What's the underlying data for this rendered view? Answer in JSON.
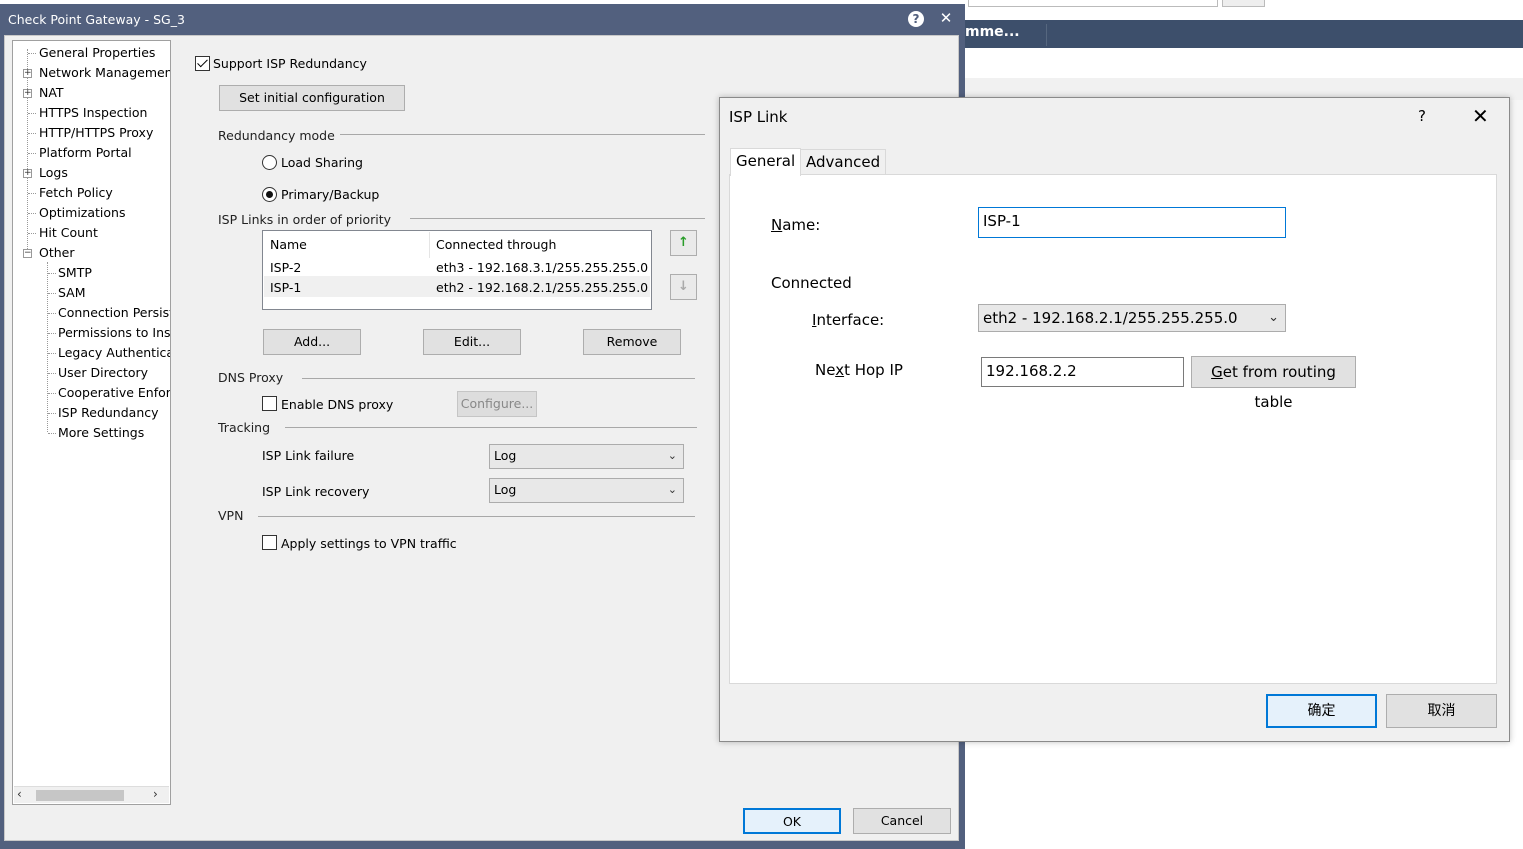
{
  "main_window": {
    "title": "Check Point Gateway - SG_3",
    "tree": {
      "items": [
        {
          "label": "General Properties",
          "expander": ""
        },
        {
          "label": "Network Management",
          "expander": "+"
        },
        {
          "label": "NAT",
          "expander": "+"
        },
        {
          "label": "HTTPS Inspection",
          "expander": ""
        },
        {
          "label": "HTTP/HTTPS Proxy",
          "expander": ""
        },
        {
          "label": "Platform Portal",
          "expander": ""
        },
        {
          "label": "Logs",
          "expander": "+"
        },
        {
          "label": "Fetch Policy",
          "expander": ""
        },
        {
          "label": "Optimizations",
          "expander": ""
        },
        {
          "label": "Hit Count",
          "expander": ""
        },
        {
          "label": "Other",
          "expander": "−"
        }
      ],
      "children": [
        "SMTP",
        "SAM",
        "Connection Persiste",
        "Permissions to Insta",
        "Legacy Authenticati",
        "User Directory",
        "Cooperative Enforc",
        "ISP Redundancy",
        "More Settings"
      ]
    },
    "form": {
      "support_isp_redundancy": "Support ISP Redundancy",
      "set_initial_configuration": "Set initial configuration",
      "redundancy_mode": "Redundancy mode",
      "load_sharing": "Load Sharing",
      "primary_backup": "Primary/Backup",
      "isp_links_title": "ISP Links in order of priority",
      "list_headers": [
        "Name",
        "Connected through"
      ],
      "list_rows": [
        {
          "name": "ISP-2",
          "through": "eth3 - 192.168.3.1/255.255.255.0"
        },
        {
          "name": "ISP-1",
          "through": "eth2 - 192.168.2.1/255.255.255.0"
        }
      ],
      "add": "Add...",
      "edit": "Edit...",
      "remove": "Remove",
      "dns_proxy": "DNS Proxy",
      "enable_dns_proxy": "Enable DNS proxy",
      "configure": "Configure...",
      "tracking": "Tracking",
      "isp_link_failure": "ISP Link failure",
      "isp_link_recovery": "ISP Link recovery",
      "failure_value": "Log",
      "recovery_value": "Log",
      "vpn": "VPN",
      "apply_vpn": "Apply settings to VPN traffic"
    },
    "ok": "OK",
    "cancel": "Cancel"
  },
  "background": {
    "header_text": "mme..."
  },
  "isp_link_dialog": {
    "title": "ISP Link",
    "help": "?",
    "tabs": [
      "General",
      "Advanced"
    ],
    "name_label": "Name:",
    "name_value": "ISP-1",
    "connected_label": "Connected",
    "interface_label": "Interface:",
    "interface_value": "eth2 - 192.168.2.1/255.255.255.0",
    "next_hop_label": "Next Hop IP",
    "next_hop_value": "192.168.2.2",
    "get_from_routing": "Get from routing table",
    "ok": "确定",
    "cancel": "取消"
  },
  "colors": {
    "title_bar": "#52607e",
    "background_header": "#3d4f6b",
    "focus_blue": "#0078d7",
    "up_arrow": "#2a9d2a"
  }
}
